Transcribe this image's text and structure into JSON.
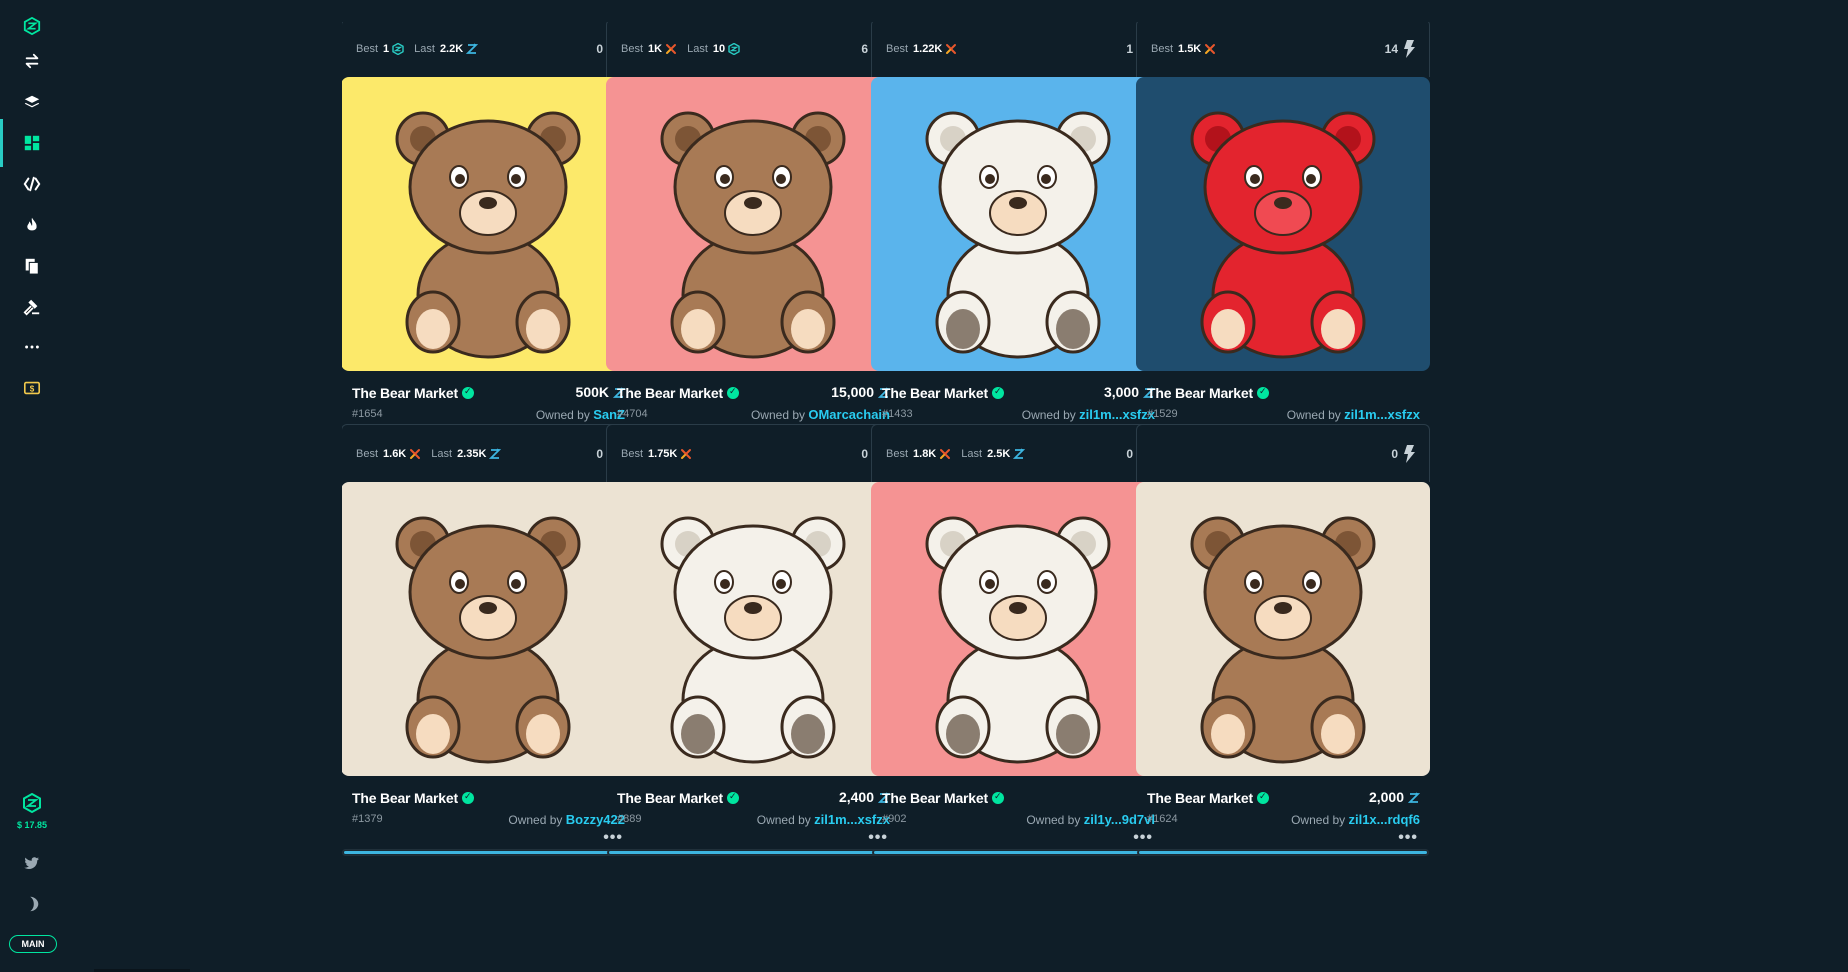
{
  "sidebar": {
    "items": [
      {
        "icon": "logo-icon"
      },
      {
        "icon": "swap-icon"
      },
      {
        "icon": "layers-icon"
      },
      {
        "icon": "dashboard-icon",
        "active": true
      },
      {
        "icon": "bridge-icon"
      },
      {
        "icon": "fire-icon"
      },
      {
        "icon": "documents-icon"
      },
      {
        "icon": "auction-icon"
      },
      {
        "icon": "more-icon"
      },
      {
        "icon": "dollar-icon"
      }
    ],
    "balance": "$ 17.85",
    "network": "MAIN",
    "colors": {
      "accent": "#00e6a0",
      "active": "#29ccc4"
    }
  },
  "cards": [
    {
      "best_label": "Best",
      "best": "1",
      "best_cur": "zil",
      "last_label": "Last",
      "last": "2.2K",
      "last_cur": "zwap",
      "likes": "0",
      "collection": "The Bear Market",
      "price": "500K",
      "price_cur": "zwap",
      "token_id": "#1654",
      "owned_label": "Owned by",
      "owner": "SanZ",
      "bg": "#fce96a",
      "bear": "brown",
      "fur": "#a87a55"
    },
    {
      "best_label": "Best",
      "best": "1K",
      "best_cur": "xcad",
      "last_label": "Last",
      "last": "10",
      "last_cur": "zil",
      "likes": "6",
      "collection": "The Bear Market",
      "price": "15,000",
      "price_cur": "zwap",
      "token_id": "#4704",
      "owned_label": "Owned by",
      "owner": "OMarcachain",
      "bg": "#f59393",
      "bear": "brown",
      "fur": "#a87a55"
    },
    {
      "best_label": "Best",
      "best": "1.22K",
      "best_cur": "xcad",
      "last_label": "",
      "last": "",
      "last_cur": "",
      "likes": "1",
      "collection": "The Bear Market",
      "price": "3,000",
      "price_cur": "zwap",
      "token_id": "#1433",
      "owned_label": "Owned by",
      "owner": "zil1m...xsfzx",
      "bg": "#5ab4ec",
      "bear": "white",
      "fur": "#f4f1ea"
    },
    {
      "best_label": "Best",
      "best": "1.5K",
      "best_cur": "xcad",
      "last_label": "",
      "last": "",
      "last_cur": "",
      "likes": "14",
      "collection": "The Bear Market",
      "price": "",
      "price_cur": "",
      "token_id": "#1529",
      "owned_label": "Owned by",
      "owner": "zil1m...xsfzx",
      "bg": "#1f4d6e",
      "bear": "red",
      "fur": "#e3242e"
    },
    {
      "best_label": "Best",
      "best": "1.6K",
      "best_cur": "xcad",
      "last_label": "Last",
      "last": "2.35K",
      "last_cur": "zwap",
      "likes": "0",
      "collection": "The Bear Market",
      "price": "",
      "price_cur": "",
      "token_id": "#1379",
      "owned_label": "Owned by",
      "owner": "Bozzy422",
      "bg": "#ece3d3",
      "bear": "brown",
      "fur": "#a87a55"
    },
    {
      "best_label": "Best",
      "best": "1.75K",
      "best_cur": "xcad",
      "last_label": "",
      "last": "",
      "last_cur": "",
      "likes": "0",
      "collection": "The Bear Market",
      "price": "2,400",
      "price_cur": "zwap",
      "token_id": "#889",
      "owned_label": "Owned by",
      "owner": "zil1m...xsfzx",
      "bg": "#ece3d3",
      "bear": "white",
      "fur": "#f4f1ea"
    },
    {
      "best_label": "Best",
      "best": "1.8K",
      "best_cur": "xcad",
      "last_label": "Last",
      "last": "2.5K",
      "last_cur": "zwap",
      "likes": "0",
      "collection": "The Bear Market",
      "price": "",
      "price_cur": "",
      "token_id": "#902",
      "owned_label": "Owned by",
      "owner": "zil1y...9d7vl",
      "bg": "#f59393",
      "bear": "white",
      "fur": "#f4f1ea"
    },
    {
      "best_label": "",
      "best": "",
      "best_cur": "",
      "last_label": "",
      "last": "",
      "last_cur": "",
      "likes": "0",
      "collection": "The Bear Market",
      "price": "2,000",
      "price_cur": "zwap",
      "token_id": "#1624",
      "owned_label": "Owned by",
      "owner": "zil1x...rdqf6",
      "bg": "#ece3d3",
      "bear": "brown",
      "fur": "#a87a55"
    }
  ],
  "colors": {
    "page_bg": "#0f1e28",
    "card_border": "#2a3c48",
    "zil": "#29ccc4",
    "zwap": "#3db5e0",
    "xcad": "#e8562c",
    "owner_link": "#29ccf0",
    "bar": "#3db5e0"
  }
}
